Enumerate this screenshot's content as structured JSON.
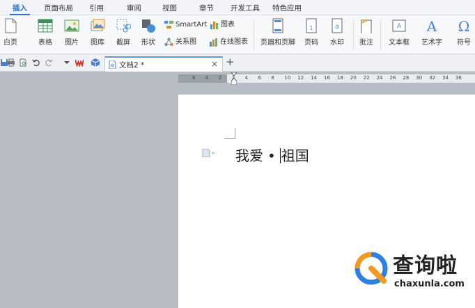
{
  "tabs": [
    {
      "label": "插入",
      "active": true
    },
    {
      "label": "页面布局"
    },
    {
      "label": "引用"
    },
    {
      "label": "审阅"
    },
    {
      "label": "视图"
    },
    {
      "label": "章节"
    },
    {
      "label": "开发工具"
    },
    {
      "label": "特色应用"
    }
  ],
  "ribbon": {
    "blank_page": "白页",
    "table": "表格",
    "picture": "图片",
    "gallery": "图库",
    "screenshot": "截屏",
    "shape": "形状",
    "smartart": "SmartArt",
    "chart": "图表",
    "relation": "关系图",
    "online_chart": "在线图表",
    "header_footer": "页眉和页脚",
    "page_number": "页码",
    "watermark": "水印",
    "comment": "批注",
    "textbox": "文本框",
    "wordart": "艺术字",
    "symbol": "符号"
  },
  "document_tab": {
    "title": "文档2 *",
    "close": "×",
    "add": "+"
  },
  "ruler": {
    "ticks": [
      "6",
      "4",
      "2",
      "2",
      "4",
      "6",
      "8",
      "10",
      "12",
      "14",
      "16",
      "18",
      "20",
      "22",
      "24",
      "26",
      "28",
      "30",
      "32",
      "34",
      "36"
    ]
  },
  "document": {
    "before_cursor": "我爱",
    "bullet": "•",
    "after_cursor": "祖国"
  },
  "watermark": {
    "brand": "查询啦",
    "url": "chaxunla.com"
  },
  "colors": {
    "accent": "#2a6fd1",
    "tab_line": "#5b9bd5",
    "workspace": "#b7bcc5",
    "logo_blue": "#2f7fe0",
    "logo_orange": "#f39a1e"
  }
}
